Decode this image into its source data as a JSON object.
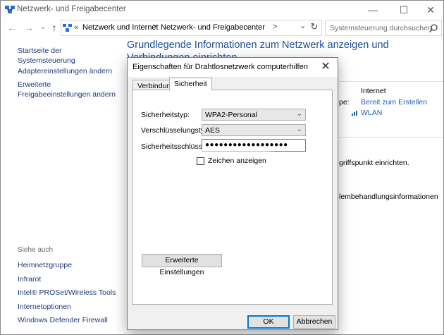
{
  "window": {
    "title": "Netzwerk- und Freigabecenter",
    "minimize": "—",
    "maximize": "☐",
    "close": "✕"
  },
  "address_bar": {
    "overflow": "«",
    "crumb1": "Netzwerk und Internet",
    "separator1": ">",
    "crumb2": "Netzwerk- und Freigabecenter",
    "separator2": ">",
    "dropdown": "⌄",
    "refresh": "↻",
    "search_placeholder": "Systemsteuerung durchsuchen"
  },
  "nav": {
    "back": "←",
    "forward": "→",
    "recent": "⌄",
    "up": "↑"
  },
  "sidebar": {
    "links": [
      "Startseite der Systemsteuerung",
      "Adaptereinstellungen ändern",
      "Erweiterte\nFreigabeeinstellungen ändern"
    ],
    "see_also_heading": "Siehe auch",
    "see_also": [
      "Heimnetzgruppe",
      "Infrarot",
      "Intel® PROSet/Wireless Tools",
      "Internetoptionen",
      "Windows Defender Firewall"
    ]
  },
  "main": {
    "heading": "Grundlegende Informationen zum Netzwerk anzeigen und Verbindungen einrichten",
    "access_type_value": "Internet",
    "homegroup_label": "pe:",
    "homegroup_link": "Bereit zum Erstellen",
    "connection_link": "WLAN",
    "setup_text": "griffspunkt einrichten.",
    "troubleshoot_text": "lembehandlungsinformationen"
  },
  "dialog": {
    "title": "Eigenschaften für Drahtlosnetzwerk computerhilfen",
    "close": "✕",
    "tabs": [
      "Verbindung",
      "Sicherheit"
    ],
    "active_tab": "Sicherheit",
    "security_type_label": "Sicherheitstyp:",
    "security_type_value": "WPA2-Personal",
    "encryption_label": "Verschlüsselungstyp:",
    "encryption_value": "AES",
    "key_label": "Sicherheitsschlüssel",
    "key_value": "●●●●●●●●●●●●●●●●●●",
    "show_chars_label": "Zeichen anzeigen",
    "show_chars_checked": false,
    "advanced_button": "Erweiterte Einstellungen",
    "ok_button": "OK",
    "cancel_button": "Abbrechen"
  }
}
